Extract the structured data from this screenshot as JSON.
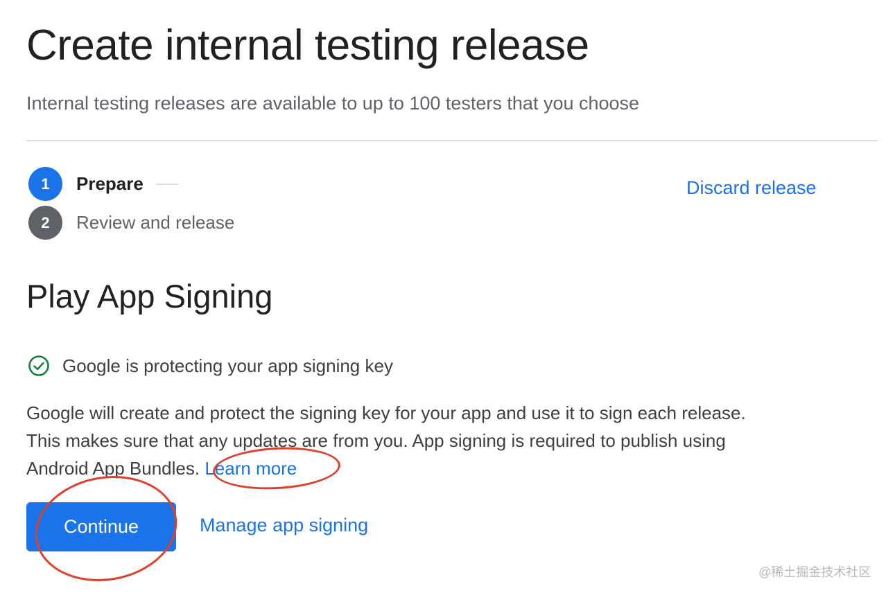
{
  "page": {
    "title": "Create internal testing release",
    "subtitle": "Internal testing releases are available to up to 100 testers that you choose"
  },
  "stepper": {
    "steps": [
      {
        "number": "1",
        "label": "Prepare",
        "state": "active"
      },
      {
        "number": "2",
        "label": "Review and release",
        "state": "inactive"
      }
    ]
  },
  "actions": {
    "discard_label": "Discard release"
  },
  "app_signing": {
    "section_title": "Play App Signing",
    "status_icon": "check-circle-icon",
    "status_text": "Google is protecting your app signing key",
    "description_line1": "Google will create and protect the signing key for your app and use it to sign each release.",
    "description_line2": "This makes sure that any updates are from you. App signing is required to publish using",
    "description_line3": "Android App Bundles.",
    "learn_more_label": "Learn more",
    "continue_label": "Continue",
    "manage_label": "Manage app signing"
  },
  "colors": {
    "accent": "#1a73e8",
    "success": "#188038",
    "annotation": "#e0402a",
    "inactive_step": "#5f6368"
  },
  "watermark": "@稀土掘金技术社区"
}
